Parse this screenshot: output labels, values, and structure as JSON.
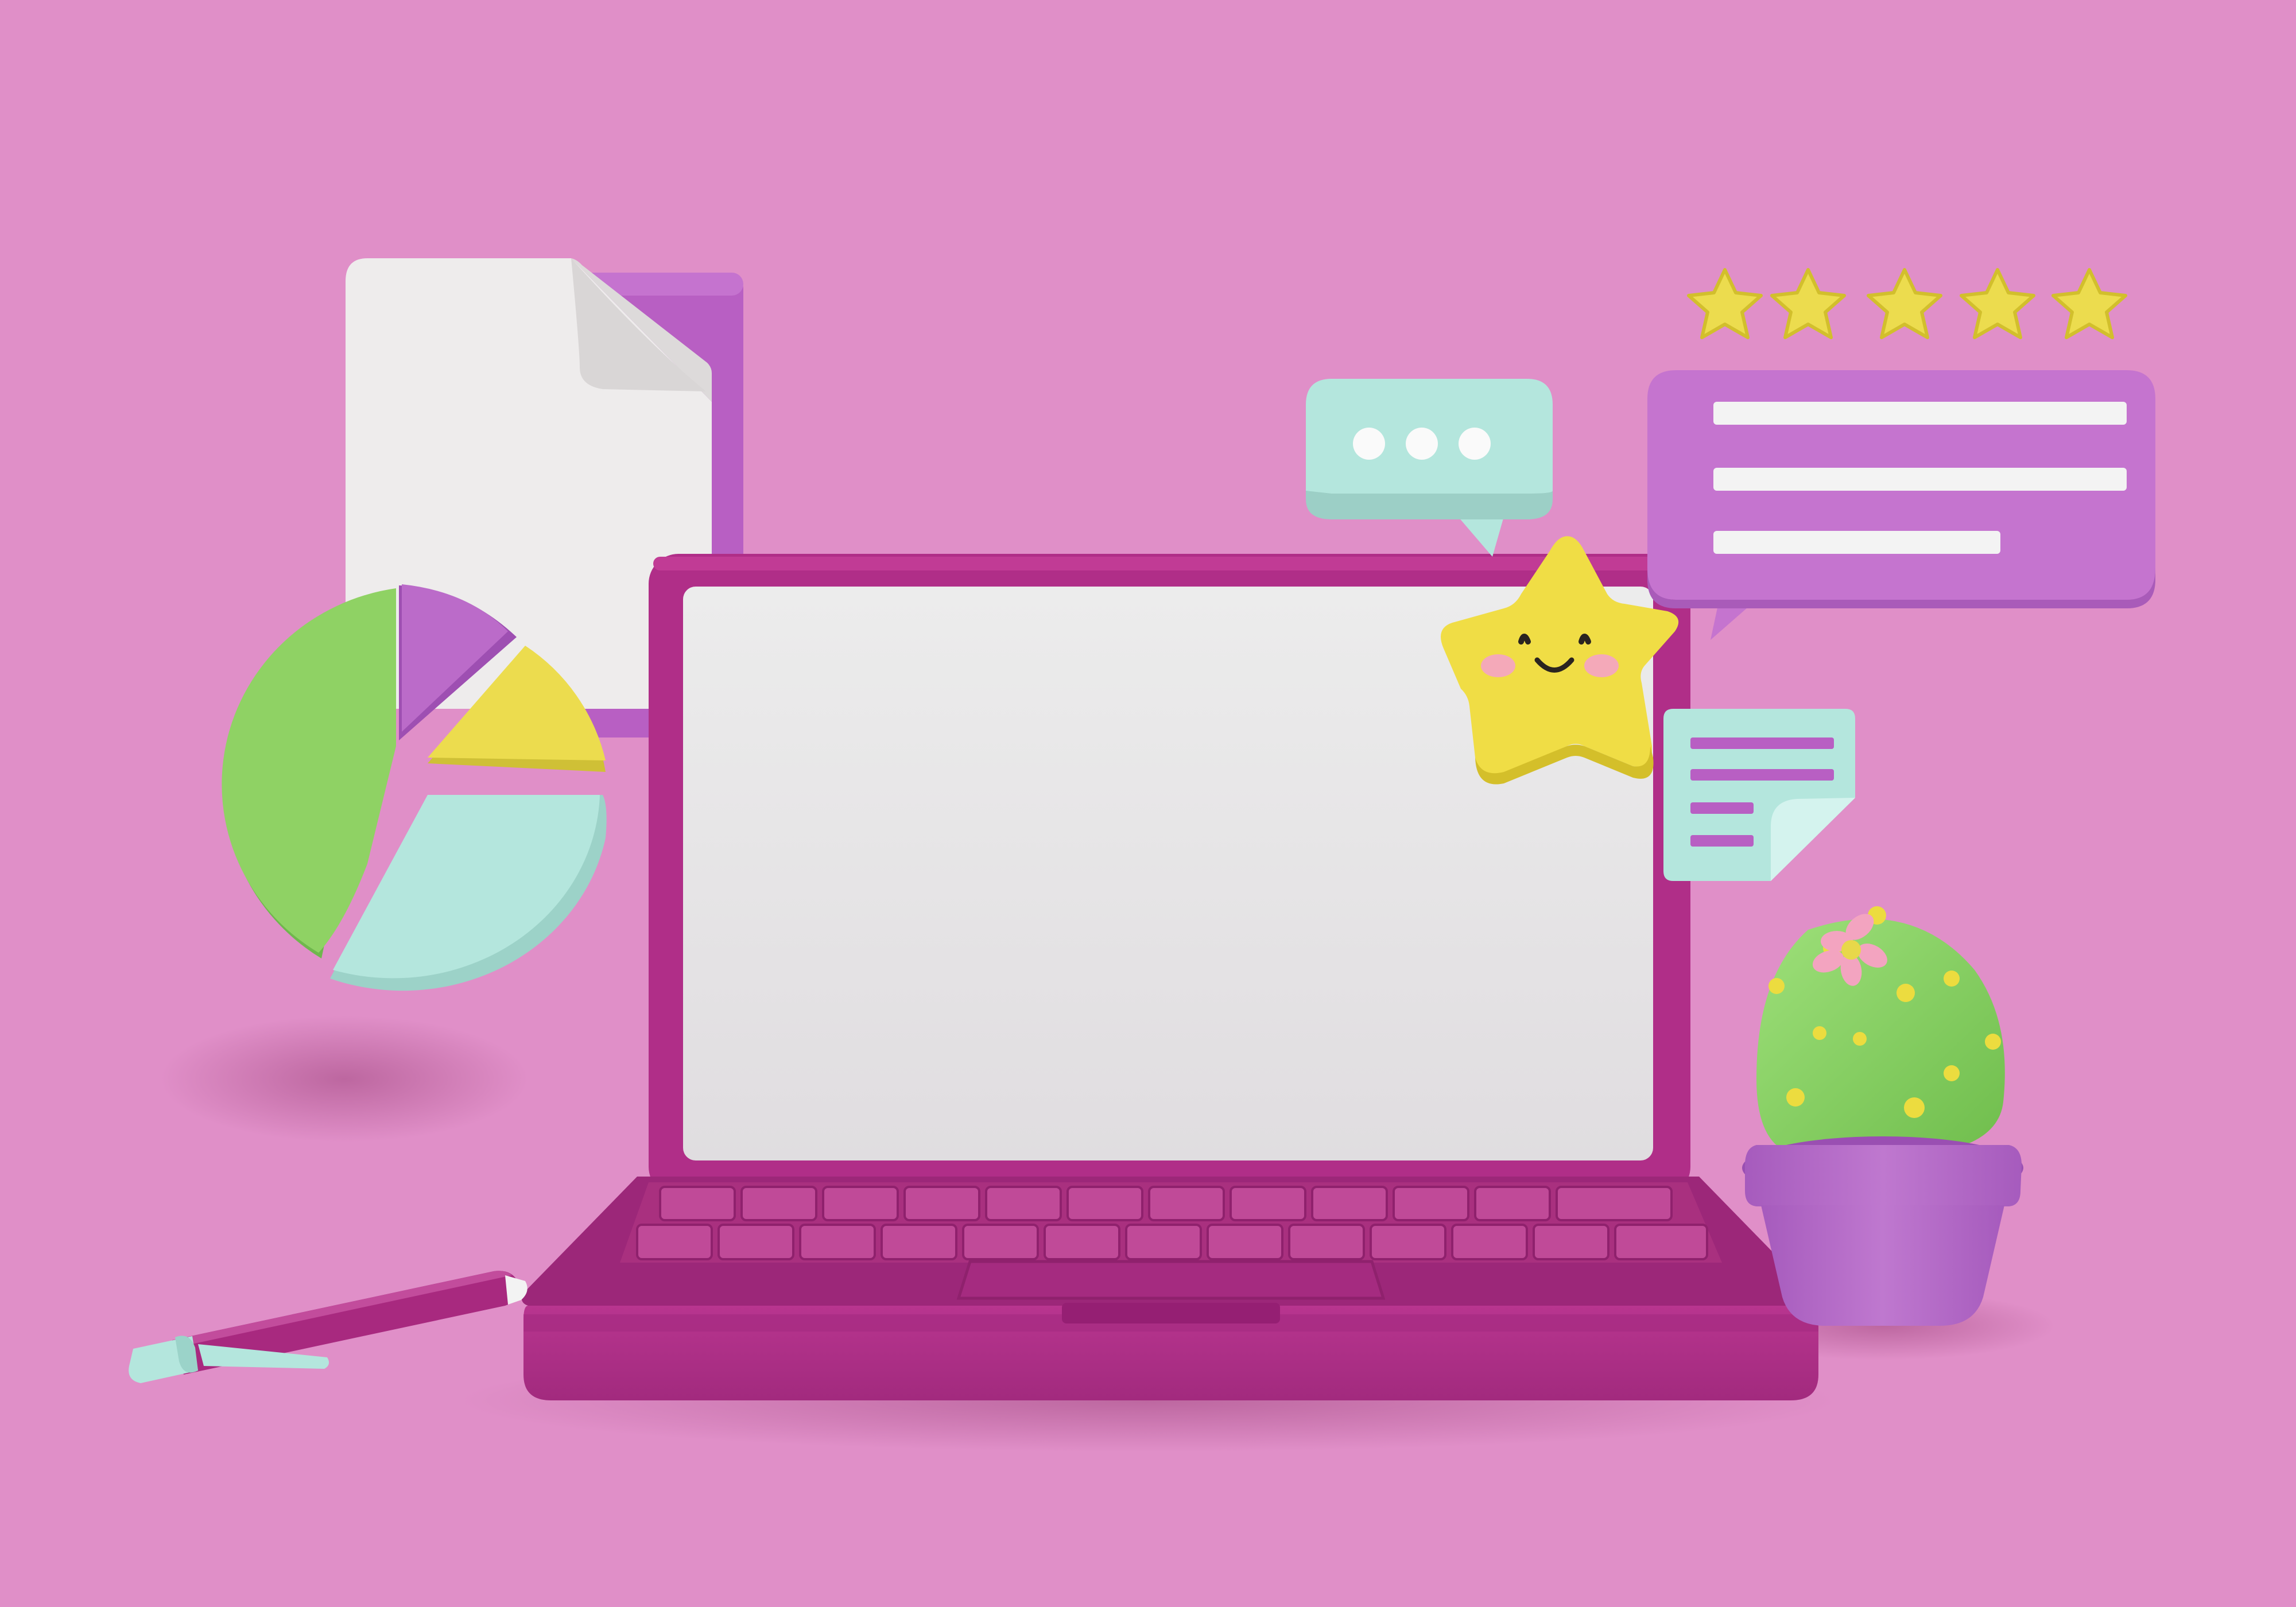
{
  "colors": {
    "background": "#e08fc8",
    "laptop": "#b02e88",
    "laptop_dark": "#8e1f6c",
    "screen": "#e6e4e6",
    "purple": "#b96bc6",
    "green": "#8fd264",
    "yellow": "#e8d84a",
    "mint": "#b4e6dd",
    "paper": "#efeded"
  },
  "icons": {
    "document": "document-icon",
    "pie_chart": "pie-chart-icon",
    "typing_bubble": "typing-bubble-icon",
    "rating_stars": "five-star-rating-icon",
    "review_bubble": "review-bubble-icon",
    "smiley_star": "smiley-star-icon",
    "sticky_note": "sticky-note-icon",
    "cactus": "cactus-plant-icon",
    "pen": "pen-icon",
    "laptop": "laptop-icon"
  },
  "rating": {
    "stars": 5,
    "max": 5
  },
  "pie_chart": {
    "slices": 4
  }
}
